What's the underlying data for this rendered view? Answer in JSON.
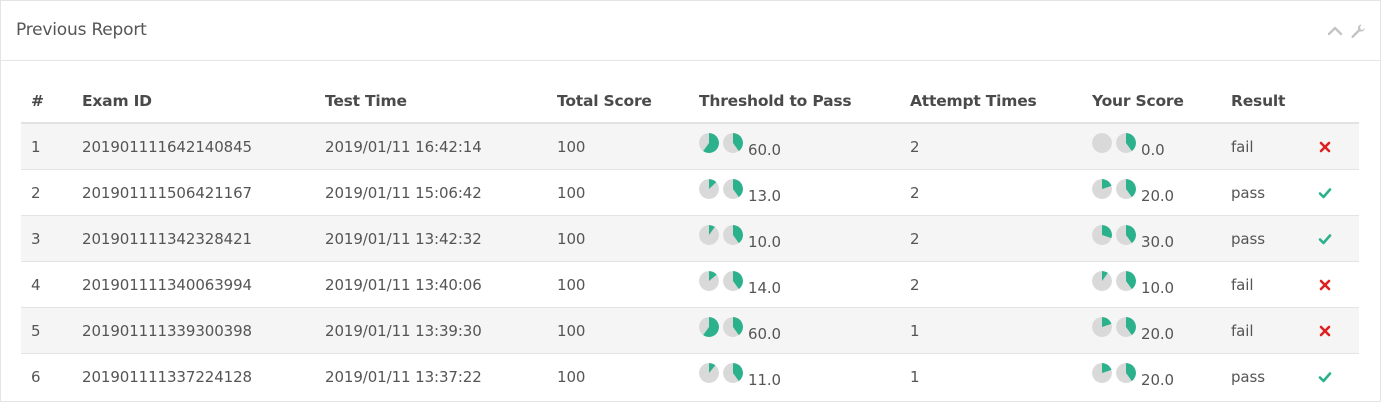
{
  "panel": {
    "title": "Previous Report",
    "collapse_icon": "chevron-up-icon",
    "settings_icon": "wrench-icon"
  },
  "colors": {
    "pie_fill": "#2bb28c",
    "pie_bg": "#d9d9d9",
    "fail": "#e02020",
    "pass": "#2bb28c"
  },
  "columns": [
    "#",
    "Exam ID",
    "Test Time",
    "Total Score",
    "Threshold to Pass",
    "Attempt Times",
    "Your Score",
    "Result"
  ],
  "rows": [
    {
      "index": "1",
      "exam_id": "201901111642140845",
      "test_time": "2019/01/11  16:42:14",
      "total_score": "100",
      "threshold": "60.0",
      "threshold_fraction": 0.6,
      "attempts": "2",
      "your_score": "0.0",
      "score_fraction": 0.0,
      "result": "fail"
    },
    {
      "index": "2",
      "exam_id": "201901111506421167",
      "test_time": "2019/01/11  15:06:42",
      "total_score": "100",
      "threshold": "13.0",
      "threshold_fraction": 0.13,
      "attempts": "2",
      "your_score": "20.0",
      "score_fraction": 0.2,
      "result": "pass"
    },
    {
      "index": "3",
      "exam_id": "201901111342328421",
      "test_time": "2019/01/11  13:42:32",
      "total_score": "100",
      "threshold": "10.0",
      "threshold_fraction": 0.1,
      "attempts": "2",
      "your_score": "30.0",
      "score_fraction": 0.3,
      "result": "pass"
    },
    {
      "index": "4",
      "exam_id": "201901111340063994",
      "test_time": "2019/01/11  13:40:06",
      "total_score": "100",
      "threshold": "14.0",
      "threshold_fraction": 0.14,
      "attempts": "2",
      "your_score": "10.0",
      "score_fraction": 0.1,
      "result": "fail"
    },
    {
      "index": "5",
      "exam_id": "201901111339300398",
      "test_time": "2019/01/11  13:39:30",
      "total_score": "100",
      "threshold": "60.0",
      "threshold_fraction": 0.6,
      "attempts": "1",
      "your_score": "20.0",
      "score_fraction": 0.2,
      "result": "fail"
    },
    {
      "index": "6",
      "exam_id": "201901111337224128",
      "test_time": "2019/01/11  13:37:22",
      "total_score": "100",
      "threshold": "11.0",
      "threshold_fraction": 0.11,
      "attempts": "1",
      "your_score": "20.0",
      "score_fraction": 0.2,
      "result": "pass"
    }
  ]
}
